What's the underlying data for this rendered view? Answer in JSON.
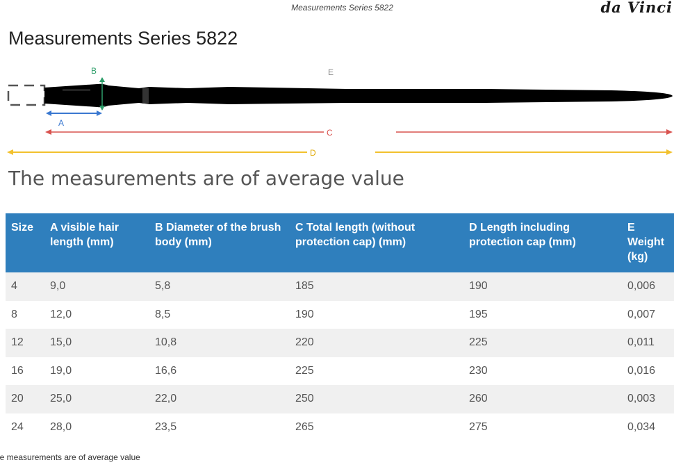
{
  "header": {
    "doc_title": "Measurements Series 5822",
    "brand": "da Vinci"
  },
  "page_title": "Measurements Series 5822",
  "diagram": {
    "labels": {
      "a": "A",
      "b": "B",
      "c": "C",
      "d": "D",
      "e": "E"
    },
    "colors": {
      "a": "#3a78d0",
      "b": "#2e9e6a",
      "c": "#d9534f",
      "d": "#f2c12e",
      "brush": "#000000"
    }
  },
  "subtitle": "The measurements are of average value",
  "table": {
    "headers": [
      "Size",
      "A visible hair length (mm)",
      "B Diameter of the brush body (mm)",
      "C Total length (without protection cap) (mm)",
      "D Length including protection cap (mm)",
      "E Weight (kg)"
    ],
    "rows": [
      [
        "4",
        "9,0",
        "5,8",
        "185",
        "190",
        "0,006"
      ],
      [
        "8",
        "12,0",
        "8,5",
        "190",
        "195",
        "0,007"
      ],
      [
        "12",
        "15,0",
        "10,8",
        "220",
        "225",
        "0,011"
      ],
      [
        "16",
        "19,0",
        "16,6",
        "225",
        "230",
        "0,016"
      ],
      [
        "20",
        "25,0",
        "22,0",
        "250",
        "260",
        "0,003"
      ],
      [
        "24",
        "28,0",
        "23,5",
        "265",
        "275",
        "0,034"
      ]
    ],
    "header_color": "#2f7fbd"
  },
  "footnote": "he measurements are of average value"
}
